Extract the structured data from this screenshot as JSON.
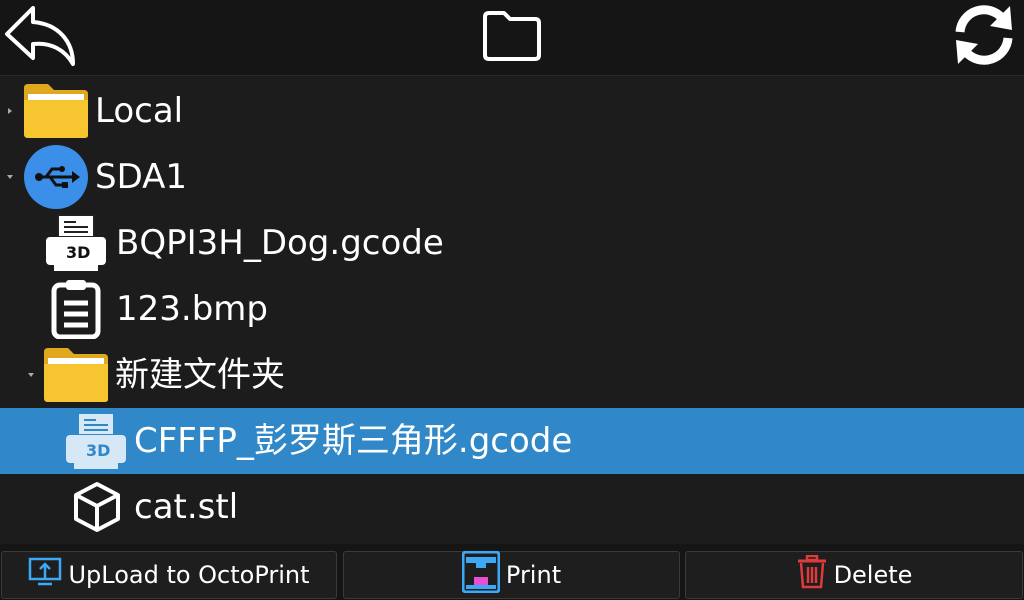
{
  "toolbar": {
    "back_icon": "back-arrow-icon",
    "folder_icon": "folder-outline-icon",
    "refresh_icon": "refresh-icon"
  },
  "tree": {
    "items": [
      {
        "label": "Local",
        "icon": "folder-icon",
        "expanded": false
      },
      {
        "label": "SDA1",
        "icon": "usb-drive-icon",
        "expanded": true
      },
      {
        "label": "BQPI3H_Dog.gcode",
        "icon": "gcode-3d-file-icon"
      },
      {
        "label": "123.bmp",
        "icon": "document-icon"
      },
      {
        "label": "新建文件夹",
        "icon": "folder-icon",
        "expanded": true
      },
      {
        "label": "CFFFP_彭罗斯三角形.gcode",
        "icon": "gcode-3d-file-icon",
        "selected": true
      },
      {
        "label": "cat.stl",
        "icon": "cube-icon"
      }
    ]
  },
  "actions": {
    "upload_label": "UpLoad to OctoPrint",
    "print_label": "Print",
    "delete_label": "Delete"
  },
  "colors": {
    "background": "#151515",
    "selection": "#3088c8",
    "folder": "#f5c32c",
    "usb": "#3b8fe8",
    "upload_icon": "#3da8f5",
    "delete_icon": "#e03b3b"
  }
}
